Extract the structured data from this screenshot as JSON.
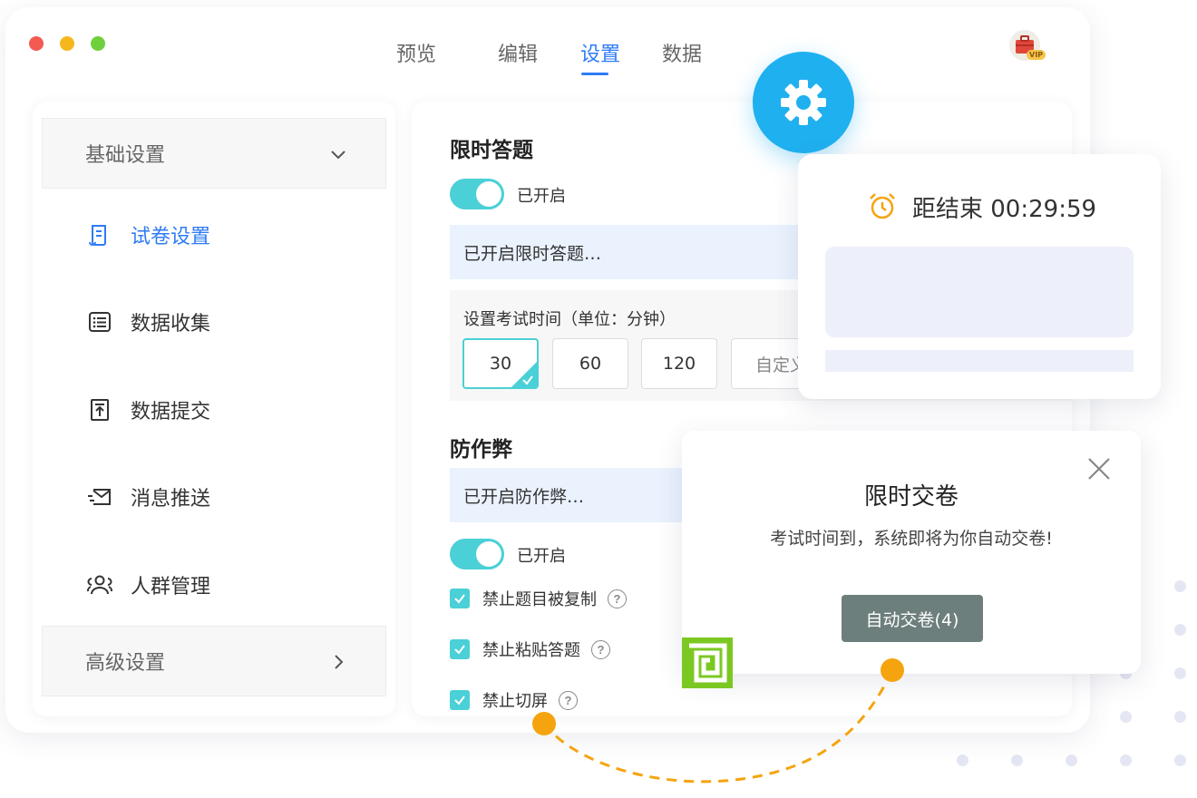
{
  "window": {
    "traffic_colors": [
      "#f25a52",
      "#f6b71d",
      "#6fcf3c"
    ]
  },
  "top_nav": {
    "tabs": [
      {
        "label": "预览",
        "active": false
      },
      {
        "label": "编辑",
        "active": false
      },
      {
        "label": "设置",
        "active": true
      },
      {
        "label": "数据",
        "active": false
      }
    ]
  },
  "account": {
    "avatar_icon": "briefcase-icon",
    "vip_badge": "VIP"
  },
  "sidebar": {
    "basic_section": {
      "label": "基础设置",
      "icon": "chevron-down-icon"
    },
    "items": [
      {
        "label": "试卷设置",
        "icon": "scroll-doc-icon",
        "active": true
      },
      {
        "label": "数据收集",
        "icon": "list-form-icon",
        "active": false
      },
      {
        "label": "数据提交",
        "icon": "upload-doc-icon",
        "active": false
      },
      {
        "label": "消息推送",
        "icon": "send-mail-icon",
        "active": false
      },
      {
        "label": "人群管理",
        "icon": "users-icon",
        "active": false
      }
    ],
    "advanced_section": {
      "label": "高级设置",
      "icon": "chevron-right-icon"
    }
  },
  "timed_answer": {
    "title": "限时答题",
    "toggle_on": true,
    "toggle_label": "已开启",
    "info": "已开启限时答题…",
    "duration_question": "设置考试时间（单位：分钟）",
    "options": [
      "30",
      "60",
      "120",
      "自定义"
    ],
    "selected": "30"
  },
  "anti_cheat": {
    "title": "防作弊",
    "info": "已开启防作弊…",
    "toggle_on": true,
    "toggle_label": "已开启",
    "rules": [
      {
        "label": "禁止题目被复制",
        "checked": true
      },
      {
        "label": "禁止粘贴答题",
        "checked": true
      },
      {
        "label": "禁止切屏",
        "checked": true
      }
    ]
  },
  "timer_card": {
    "countdown": "距结束 00:29:59",
    "icon": "alarm-clock-icon"
  },
  "dialog": {
    "title": "限时交卷",
    "message": "考试时间到，系统即将为你自动交卷!",
    "button": "自动交卷(4)"
  },
  "colors": {
    "accent_blue": "#2f7bf5",
    "teal": "#4ad0d6",
    "gear_blue": "#1fb0f0",
    "dashed_orange": "#f5a40f",
    "logo_green": "#7cc823",
    "dialog_button": "#6d7f7d"
  }
}
